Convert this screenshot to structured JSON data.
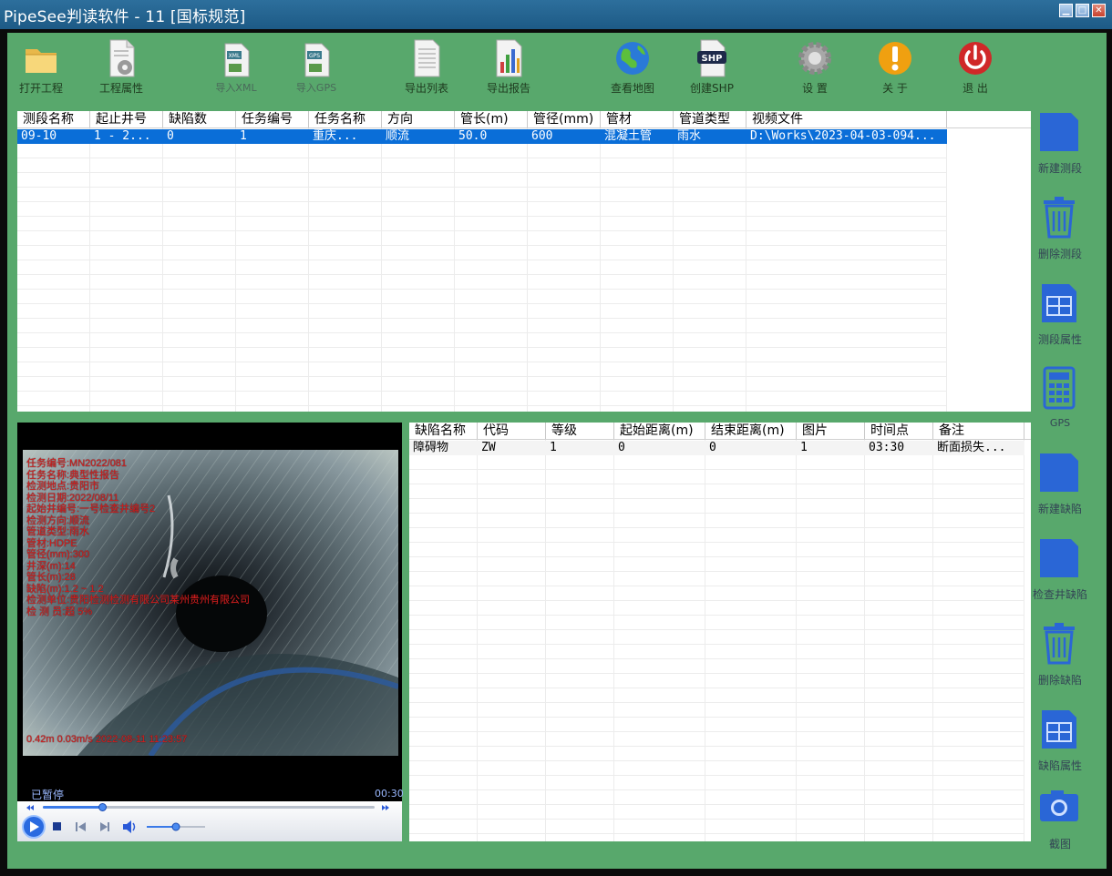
{
  "window": {
    "title": "PipeSee判读软件 - 11 [国标规范]"
  },
  "toolbar": {
    "open_project": "打开工程",
    "project_props": "工程属性",
    "import_xml": "导入XML",
    "import_gps": "导入GPS",
    "export_list": "导出列表",
    "export_report": "导出报告",
    "view_map": "查看地图",
    "create_shp": "创建SHP",
    "settings": "设  置",
    "about": "关  于",
    "exit": "退  出"
  },
  "icons": {
    "xml_badge": "XML",
    "gps_badge": "GPS",
    "shp_badge": "SHP"
  },
  "segments_table": {
    "columns": [
      "测段名称",
      "起止井号",
      "缺陷数",
      "任务编号",
      "任务名称",
      "方向",
      "管长(m)",
      "管径(mm)",
      "管材",
      "管道类型",
      "视频文件"
    ],
    "rows": [
      [
        "09-10",
        "1 - 2...",
        "0",
        "1",
        "重庆...",
        "顺流",
        "50.0",
        "600",
        "混凝土管",
        "雨水",
        "D:\\Works\\2023-04-03-094..."
      ]
    ]
  },
  "defects_table": {
    "columns": [
      "缺陷名称",
      "代码",
      "等级",
      "起始距离(m)",
      "结束距离(m)",
      "图片",
      "时间点",
      "备注"
    ],
    "rows": [
      [
        "障碍物",
        "ZW",
        "1",
        "0",
        "0",
        "1",
        "03:30",
        "断面损失..."
      ]
    ]
  },
  "sidebar": {
    "new_segment": "新建测段",
    "delete_segment": "删除测段",
    "segment_props": "测段属性",
    "gps": "GPS",
    "new_defect": "新建缺陷",
    "check_well_defect": "检查井缺陷",
    "delete_defect": "删除缺陷",
    "defect_props": "缺陷属性",
    "screenshot": "截图"
  },
  "video": {
    "osd_lines": [
      "任务编号:MN2022/081",
      "任务名称:典型性报告",
      "检测地点:贵阳市",
      "检测日期:2022/08/11",
      "起始井编号:一号检查井编号2",
      "检测方向:顺流",
      "管道类型:雨水",
      "管材:HDPE",
      "管径(mm):300",
      "井深(m):14",
      "管长(m):28",
      "缺陷(m):1.2 ~ 1.2",
      "检测单位:贵阳检测检测有限公司某州贵州有限公司",
      "检 测 员:超 5%"
    ],
    "osd_bottom": "0.42m  0.03m/s  2022-08-11 11:23:57",
    "status": "已暂停",
    "duration": "00:30",
    "seek_progress": 0.18,
    "volume_level": 0.5
  },
  "colors": {
    "client_bg": "#58a86c",
    "titlebar": "#1d5a86",
    "selection": "#0a6ed8",
    "side_icon": "#2a66d6",
    "osd_text": "#d02020"
  }
}
